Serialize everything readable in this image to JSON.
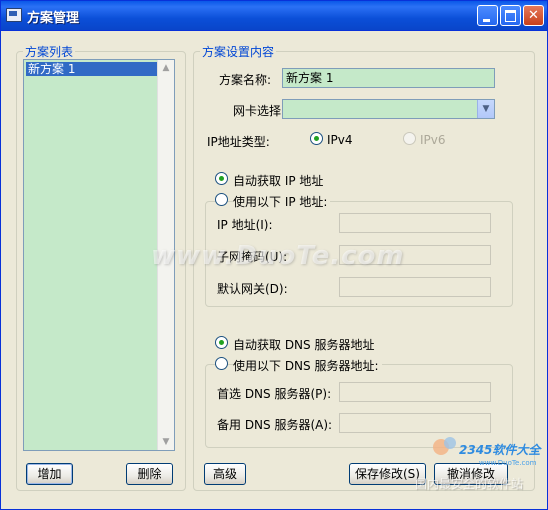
{
  "window": {
    "title": "方案管理"
  },
  "scheme_list": {
    "legend": "方案列表",
    "items": [
      "新方案 1"
    ],
    "add_button": "增加",
    "delete_button": "删除"
  },
  "settings": {
    "legend": "方案设置内容",
    "name_label": "方案名称:",
    "name_value": "新方案 1",
    "nic_label": "网卡选择:",
    "nic_value": "",
    "ip_type_label": "IP地址类型:",
    "ipv4_label": "IPv4",
    "ipv6_label": "IPv6",
    "auto_ip_label": "自动获取 IP 地址",
    "manual_ip_label": "使用以下 IP 地址:",
    "ip_label": "IP  地址(I):",
    "mask_label": "子网掩码(U):",
    "gateway_label": "默认网关(D):",
    "ip_value": "",
    "mask_value": "",
    "gateway_value": "",
    "auto_dns_label": "自动获取 DNS 服务器地址",
    "manual_dns_label": "使用以下 DNS 服务器地址:",
    "dns1_label": "首选 DNS 服务器(P):",
    "dns2_label": "备用 DNS 服务器(A):",
    "dns1_value": "",
    "dns2_value": ""
  },
  "buttons": {
    "advanced": "高级",
    "save": "保存修改(S)",
    "cancel": "撤消修改"
  },
  "watermarks": {
    "main": "www.DuoTe.com",
    "brand": "2345软件大全",
    "site": "www.DuoTe.com",
    "slogan": "国内最安全的软件站"
  }
}
